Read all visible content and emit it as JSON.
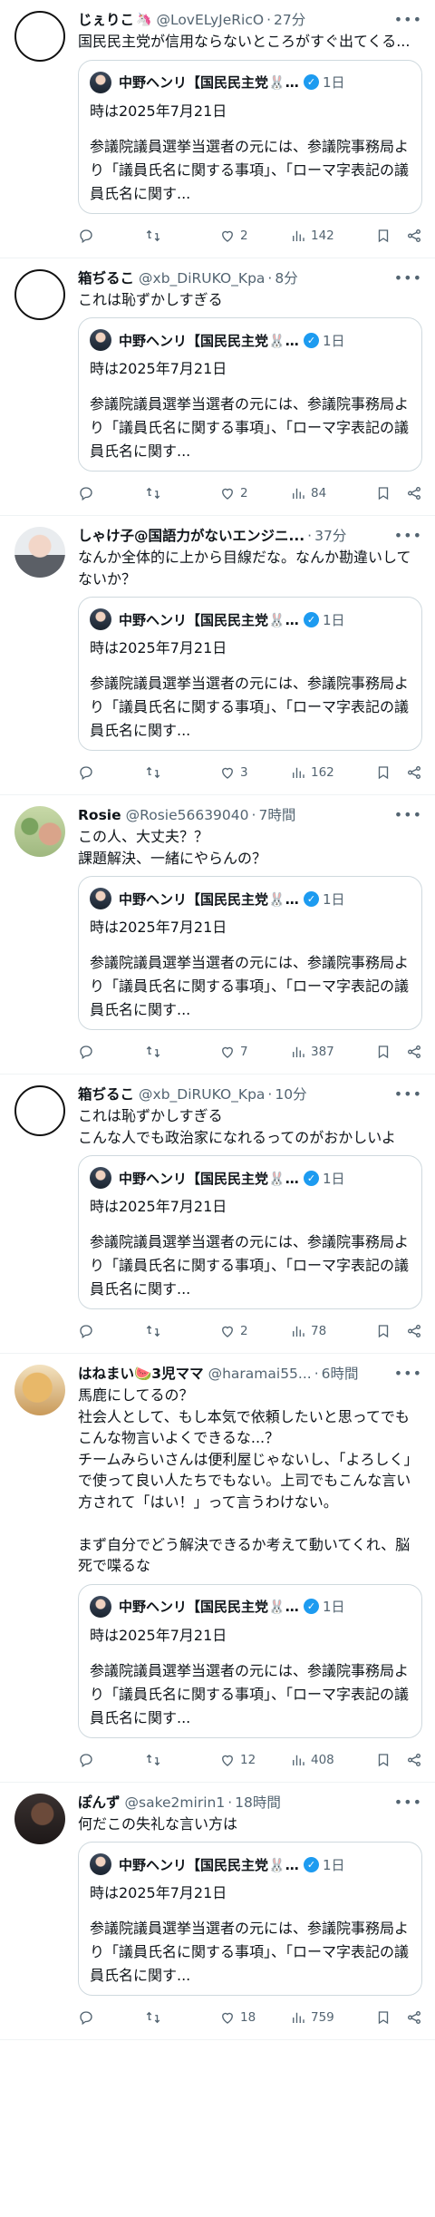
{
  "quote": {
    "name": "中野ヘンリ【国民民主党🐰🐰",
    "time": "1日",
    "date": "時は2025年7月21日",
    "body": "参議院議員選挙当選者の元には、参議院事務局より「議員氏名に関する事項」、「ローマ字表記の議員氏名に関す..."
  },
  "posts": [
    {
      "name": "じぇりこ",
      "emoji": "🦄",
      "handle": "@LovELyJeRicO",
      "time": "27分",
      "text": "国民民主党が信用ならないところがすぐ出てくる...",
      "replies": "",
      "retweets": "",
      "likes": "2",
      "views": "142",
      "avatar": "mask"
    },
    {
      "name": "箱ぢるこ",
      "emoji": "",
      "handle": "@xb_DiRUKO_Kpa",
      "time": "8分",
      "text": "これは恥ずかしすぎる",
      "replies": "",
      "retweets": "",
      "likes": "2",
      "views": "84",
      "avatar": "chiruko"
    },
    {
      "name": "しゃけ子@国語力がないエンジニ...",
      "emoji": "",
      "handle": "",
      "time": "37分",
      "text": "なんか全体的に上から目線だな。なんか勘違いしてないか？",
      "replies": "",
      "retweets": "",
      "likes": "3",
      "views": "162",
      "avatar": "photo"
    },
    {
      "name": "Rosie",
      "emoji": "",
      "handle": "@Rosie56639040",
      "time": "7時間",
      "text": "この人、大丈夫？？\n課題解決、一緒にやらんの？",
      "replies": "",
      "retweets": "",
      "likes": "7",
      "views": "387",
      "avatar": "rosie"
    },
    {
      "name": "箱ぢるこ",
      "emoji": "",
      "handle": "@xb_DiRUKO_Kpa",
      "time": "10分",
      "text": "これは恥ずかしすぎる\nこんな人でも政治家になれるってのがおかしいよ",
      "replies": "",
      "retweets": "",
      "likes": "2",
      "views": "78",
      "avatar": "chiruko"
    },
    {
      "name": "はねまい🍉3児ママ",
      "emoji": "",
      "handle": "@haramai55...",
      "time": "6時間",
      "text": "馬鹿にしてるの？\n社会人として、もし本気で依頼したいと思ってでもこんな物言いよくできるな...？\nチームみらいさんは便利屋じゃないし、「よろしく」で使って良い人たちでもない。上司でもこんな言い方されて「はい！」って言うわけない。\n\nまず自分でどう解決できるか考えて動いてくれ、脳死で喋るな",
      "replies": "",
      "retweets": "",
      "likes": "12",
      "views": "408",
      "avatar": "food"
    },
    {
      "name": "ぽんず",
      "emoji": "",
      "handle": "@sake2mirin1",
      "time": "18時間",
      "text": "何だこの失礼な言い方は",
      "replies": "",
      "retweets": "",
      "likes": "18",
      "views": "759",
      "avatar": "dark"
    }
  ],
  "icons": {
    "reply": "reply-icon",
    "retweet": "retweet-icon",
    "like": "heart-icon",
    "views": "views-icon",
    "bookmark": "bookmark-icon",
    "share": "share-icon",
    "more": "more-icon",
    "verified": "verified-badge-icon"
  }
}
